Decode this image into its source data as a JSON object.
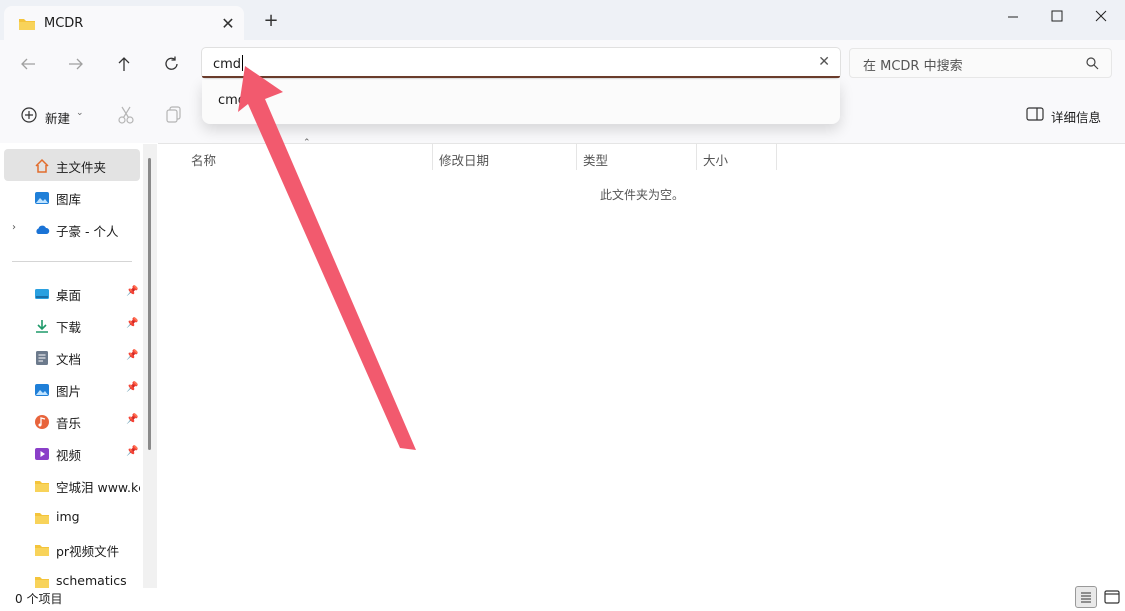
{
  "window": {
    "tab_title": "MCDR",
    "new_tab_label": "+",
    "close_tab_glyph": "✕"
  },
  "address_bar": {
    "value": "cmd",
    "suggestion": "cmd"
  },
  "search": {
    "placeholder": "在 MCDR 中搜索"
  },
  "toolbar": {
    "new_label": "新建",
    "details_label": "详细信息"
  },
  "sidebar": {
    "items": [
      {
        "label": "主文件夹",
        "icon": "home-icon"
      },
      {
        "label": "图库",
        "icon": "gallery-icon"
      },
      {
        "label": "子豪 - 个人",
        "icon": "onedrive-cloud-icon"
      },
      {
        "label": "桌面",
        "icon": "desktop-icon"
      },
      {
        "label": "下载",
        "icon": "download-icon"
      },
      {
        "label": "文档",
        "icon": "documents-icon"
      },
      {
        "label": "图片",
        "icon": "pictures-icon"
      },
      {
        "label": "音乐",
        "icon": "music-icon"
      },
      {
        "label": "视频",
        "icon": "videos-icon"
      },
      {
        "label": "空城泪 www.kc",
        "icon": "folder-icon"
      },
      {
        "label": "img",
        "icon": "folder-icon"
      },
      {
        "label": "pr视频文件",
        "icon": "folder-icon"
      },
      {
        "label": "schematics",
        "icon": "folder-icon"
      }
    ]
  },
  "columns": [
    "名称",
    "修改日期",
    "类型",
    "大小"
  ],
  "empty_message": "此文件夹为空。",
  "status": {
    "item_count": "0 个项目"
  },
  "colors": {
    "accent_underline": "#6b3c2c",
    "annotation_arrow": "#f25a6e",
    "folder_yellow": "#f4c43b"
  }
}
